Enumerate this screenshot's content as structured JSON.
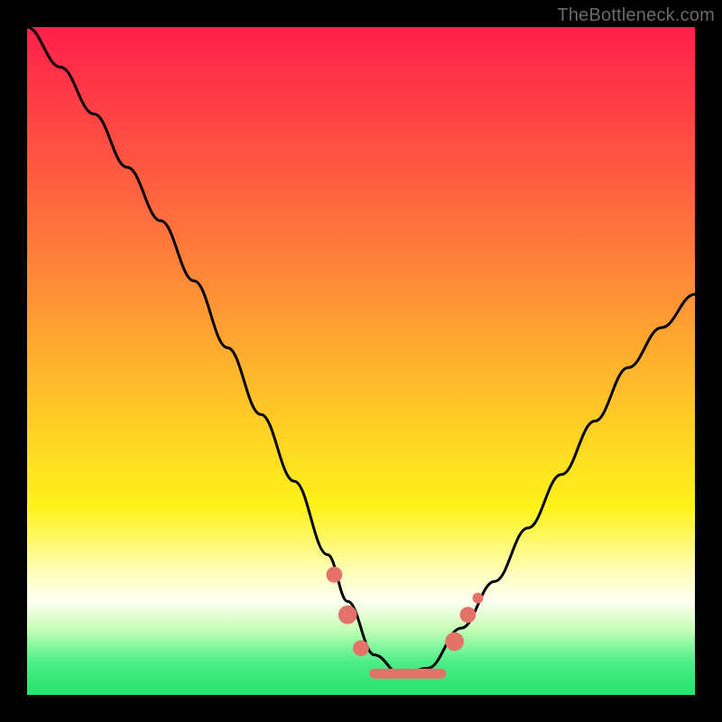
{
  "watermark": "TheBottleneck.com",
  "chart_data": {
    "type": "line",
    "title": "",
    "xlabel": "",
    "ylabel": "",
    "xlim": [
      0,
      100
    ],
    "ylim": [
      0,
      100
    ],
    "grid": false,
    "legend": false,
    "background_gradient_stops": [
      {
        "pos": 0,
        "color": "#ff1f4b"
      },
      {
        "pos": 28,
        "color": "#ff6b3e"
      },
      {
        "pos": 60,
        "color": "#ffd024"
      },
      {
        "pos": 82,
        "color": "#fffec0"
      },
      {
        "pos": 95,
        "color": "#4dee88"
      },
      {
        "pos": 100,
        "color": "#24e36b"
      }
    ],
    "series": [
      {
        "name": "left-descending-curve",
        "x": [
          0,
          5,
          10,
          15,
          20,
          25,
          30,
          35,
          40,
          45,
          48,
          52,
          56
        ],
        "y": [
          100,
          94,
          87,
          79,
          71,
          62,
          52,
          42,
          32,
          21,
          14,
          6,
          3
        ]
      },
      {
        "name": "right-ascending-curve",
        "x": [
          56,
          60,
          65,
          70,
          75,
          80,
          85,
          90,
          95,
          100
        ],
        "y": [
          3,
          4,
          10,
          17,
          25,
          33,
          41,
          49,
          55,
          60
        ]
      }
    ],
    "markers": {
      "name": "valley-highlight",
      "color": "#e5726a",
      "points": [
        {
          "x": 46,
          "y": 18,
          "r": 1.2
        },
        {
          "x": 48,
          "y": 12,
          "r": 1.4
        },
        {
          "x": 50,
          "y": 7,
          "r": 1.2
        },
        {
          "x": 64,
          "y": 8,
          "r": 1.4
        },
        {
          "x": 66,
          "y": 12,
          "r": 1.2
        },
        {
          "x": 67.5,
          "y": 14.5,
          "r": 0.8
        }
      ],
      "flat_segment": {
        "x1": 52,
        "y1": 3.2,
        "x2": 62,
        "y2": 3.2
      }
    }
  }
}
